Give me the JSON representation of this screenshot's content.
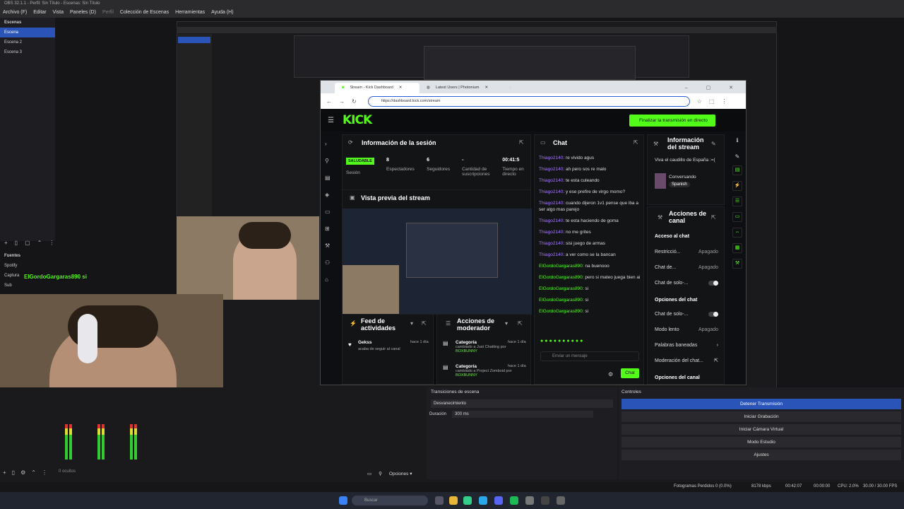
{
  "obs": {
    "title": "OBS 32.1.1 - Perfil: Sin Título - Escenas: Sin Título",
    "menu": [
      "Archivo (F)",
      "Editar",
      "Vista",
      "Paneles (D)",
      "Perfil",
      "Colección de Escenas",
      "Herramientas",
      "Ayuda (H)"
    ],
    "scenes_title": "Escenas",
    "scenes": [
      "Escena",
      "Escena 2",
      "Escena 3"
    ],
    "sources_title": "Fuentes",
    "sources": [
      "Spotify",
      "Captura",
      "Sub"
    ],
    "chat_overlay": "ElGordoGargaras890  si",
    "hidden_count": "0 ocultos",
    "options_label": "Opciones ▾",
    "transitions": {
      "title": "Transiciones de escena",
      "type": "Desvanecimiento",
      "duration_label": "Duración",
      "duration": "300 ms"
    },
    "controls": {
      "title": "Controles",
      "buttons": [
        "Detener Transmisión",
        "Iniciar Grabación",
        "Iniciar Cámara Virtual",
        "Modo Estudio",
        "Ajustes"
      ]
    },
    "status": {
      "dropped": "Fotogramas Perdidos 0 (0.0%)",
      "bitrate": "8178 kbps",
      "live": "00:42:07",
      "rec": "00:00:00",
      "cpu": "CPU: 2.0%",
      "fps": "30.00 / 30.00 FPS"
    }
  },
  "browser": {
    "tabs": [
      "Stream - Kick Dashboard",
      "Latest Users | Photonium"
    ],
    "url": "https://dashboard.kick.com/stream"
  },
  "kick": {
    "logo": "KICK",
    "stop_button": "Finalizar la transmisión en directo",
    "session": {
      "title": "Información de la sesión",
      "badge": "SALUDABLE",
      "badge_sub": "Sesión",
      "stats": [
        {
          "value": "8",
          "label": "Espectadores"
        },
        {
          "value": "6",
          "label": "Seguidores"
        },
        {
          "value": "-",
          "label": "Cantidad de suscripciones"
        },
        {
          "value": "00:41:5",
          "label": "Tiempo en directo"
        }
      ]
    },
    "preview_title": "Vista previa del stream",
    "activity": {
      "title": "Feed de actividades",
      "user": "Gekss",
      "desc": "acaba de seguir al canal",
      "time": "hace 1 día"
    },
    "modactions": {
      "title": "Acciones de moderador",
      "items": [
        {
          "label": "Categoría",
          "desc": "cambiado a Just Chatting por",
          "user": "BOXBUNNY",
          "time": "hace 1 día"
        },
        {
          "label": "Categoría",
          "desc": "cambiado a Project Zomboid por",
          "user": "BOXBUNNY",
          "time": "hace 1 día"
        }
      ]
    },
    "chat": {
      "title": "Chat",
      "placeholder": "Enviar un mensaje",
      "send": "Chat",
      "messages": [
        {
          "user": "Thiago2140",
          "text": "re vivido agus",
          "color": "purple"
        },
        {
          "user": "Thiago2140",
          "text": "ah pero sos re malo",
          "color": "purple"
        },
        {
          "user": "Thiago2140",
          "text": "te esta culeando",
          "color": "purple"
        },
        {
          "user": "Thiago2140",
          "text": "y ese prefire de virgo momo?",
          "color": "purple"
        },
        {
          "user": "Thiago2140",
          "text": "cuando dijeron 1v1 pense que iba a ser algo mas parejo",
          "color": "purple"
        },
        {
          "user": "Thiago2140",
          "text": "te esta haciendo de goma",
          "color": "purple"
        },
        {
          "user": "Thiago2140",
          "text": "no me grites",
          "color": "purple"
        },
        {
          "user": "Thiago2140",
          "text": "sisi juego de armas",
          "color": "purple"
        },
        {
          "user": "Thiago2140",
          "text": "a ver como se la bancan",
          "color": "purple"
        },
        {
          "user": "ElGordoGargaras890",
          "text": "na buenooo",
          "color": "green"
        },
        {
          "user": "ElGordoGargaras890",
          "text": "pero si mateo juega bien ai",
          "color": "green"
        },
        {
          "user": "ElGordoGargaras890",
          "text": "si",
          "color": "green"
        },
        {
          "user": "ElGordoGargaras890",
          "text": "si",
          "color": "green"
        },
        {
          "user": "ElGordoGargaras890",
          "text": "si",
          "color": "green"
        }
      ]
    },
    "streaminfo": {
      "title": "Información del stream",
      "stream_title": "Viva el caudillo de España :=(",
      "category": "Conversando",
      "language": "Spanish"
    },
    "channel": {
      "title": "Acciones de canal",
      "chat_access": "Acceso al chat",
      "rows": [
        {
          "label": "Restricció...",
          "value": "Apagado"
        },
        {
          "label": "Chat de...",
          "value": "Apagado"
        },
        {
          "label": "Chat de solo-...",
          "value": ""
        }
      ],
      "chat_options": "Opciones del chat",
      "rows2": [
        {
          "label": "Chat de solo-...",
          "value": ""
        },
        {
          "label": "Modo lento",
          "value": "Apagado"
        },
        {
          "label": "Palabras baneadas",
          "value": ""
        },
        {
          "label": "Moderación del chat...",
          "value": ""
        }
      ],
      "more": "Opciones del canal"
    }
  },
  "taskbar": {
    "search": "Buscar"
  }
}
